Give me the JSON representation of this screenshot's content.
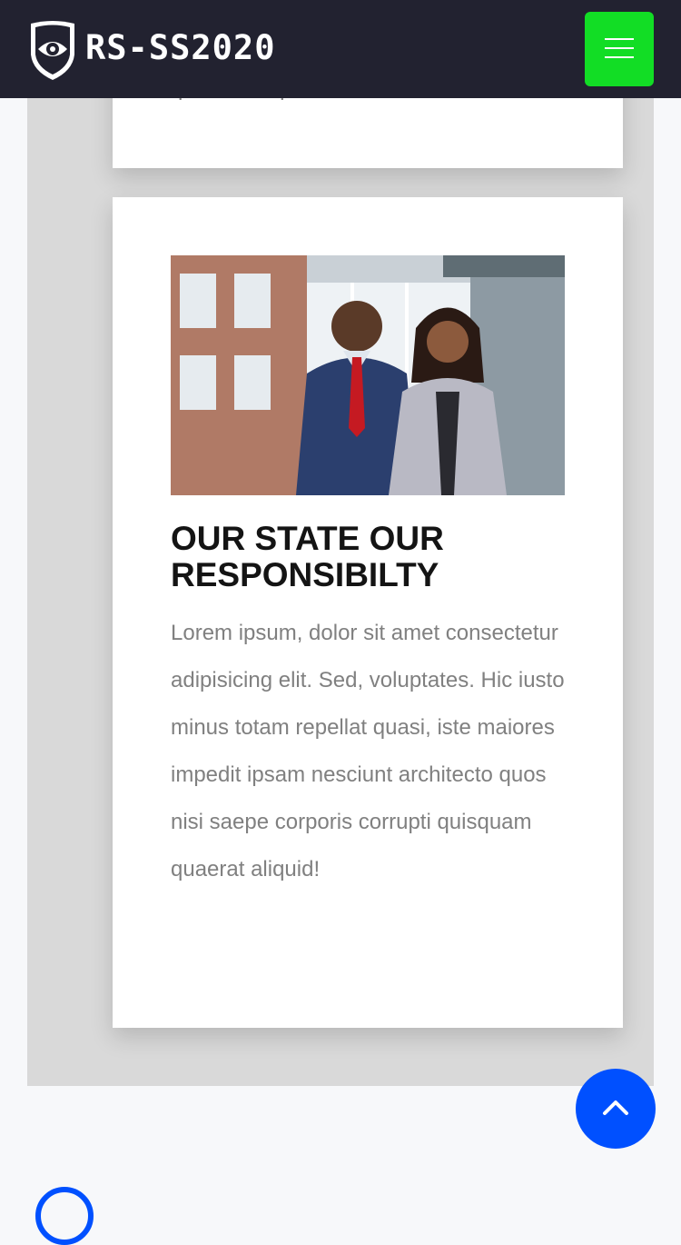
{
  "header": {
    "brand": "RS-SS2020",
    "logo_icon": "shield-eye-icon",
    "menu_icon": "hamburger-menu-icon",
    "menu_color": "#12dd25"
  },
  "previous_card": {
    "text": "saepe corporis corrupti quisquam quaerat aliquid!"
  },
  "card": {
    "image_description_icon": "business-people-photo",
    "title": "OUR STATE OUR RESPONSIBILTY",
    "body": "Lorem ipsum, dolor sit amet consectetur adipisicing elit. Sed, voluptates. Hic iusto minus totam repellat quasi, iste maiores impedit ipsam nesciunt architecto quos nisi saepe corporis corrupti quisquam quaerat aliquid!"
  },
  "back_to_top": {
    "icon": "chevron-up-icon",
    "color": "#0050ff"
  },
  "theme": {
    "header_bg": "#222230",
    "accent_blue": "#0050ff"
  }
}
